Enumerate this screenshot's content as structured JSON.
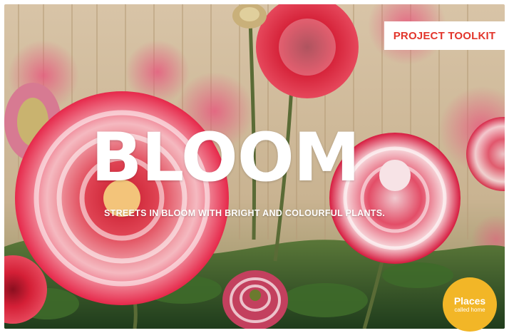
{
  "badge": {
    "label": "PROJECT TOOLKIT"
  },
  "hero": {
    "title": "BLOOM",
    "subtitle": "STREETS IN BLOOM WITH BRIGHT AND COLOURFUL PLANTS."
  },
  "logo": {
    "line1": "Places",
    "line2": "called home"
  },
  "colors": {
    "accent_red": "#e2352b",
    "logo_yellow": "#f2b627",
    "text_white": "#ffffff"
  }
}
